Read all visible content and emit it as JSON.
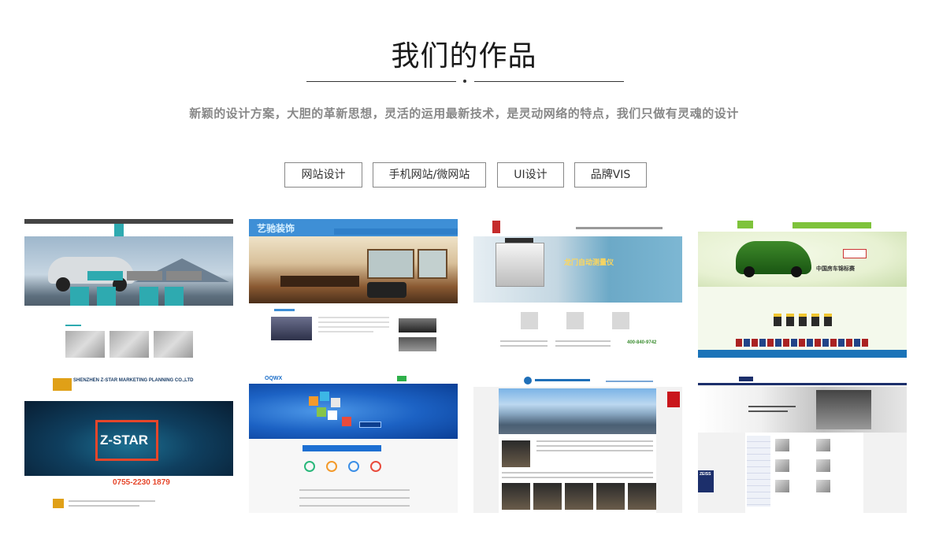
{
  "section": {
    "title": "我们的作品",
    "subtitle": "新颖的设计方案，大胆的革新思想，灵活的运用最新技术，是灵动网络的特点，我们只做有灵魂的设计"
  },
  "tabs": [
    {
      "label": "网站设计"
    },
    {
      "label": "手机网站/微网站"
    },
    {
      "label": "UI设计"
    },
    {
      "label": "品牌VIS"
    }
  ],
  "colors": {
    "title": "#1a1a1a",
    "subtitle": "#888888",
    "tab_border": "#888888"
  },
  "portfolio": {
    "t1_logo": "艺驰装饰",
    "t2_hero": "龙门自动测量仪",
    "t2_hotline": "400-840-9742",
    "t3_hero": "中国房车锦标赛",
    "t4_brand": "SHENZHEN Z-STAR MARKETING PLANNING CO.,LTD",
    "t4_title": "Z-STAR",
    "t4_phone": "0755-2230 1879",
    "t5_logo": "OQWX",
    "t7_brand": "ZEISS"
  }
}
